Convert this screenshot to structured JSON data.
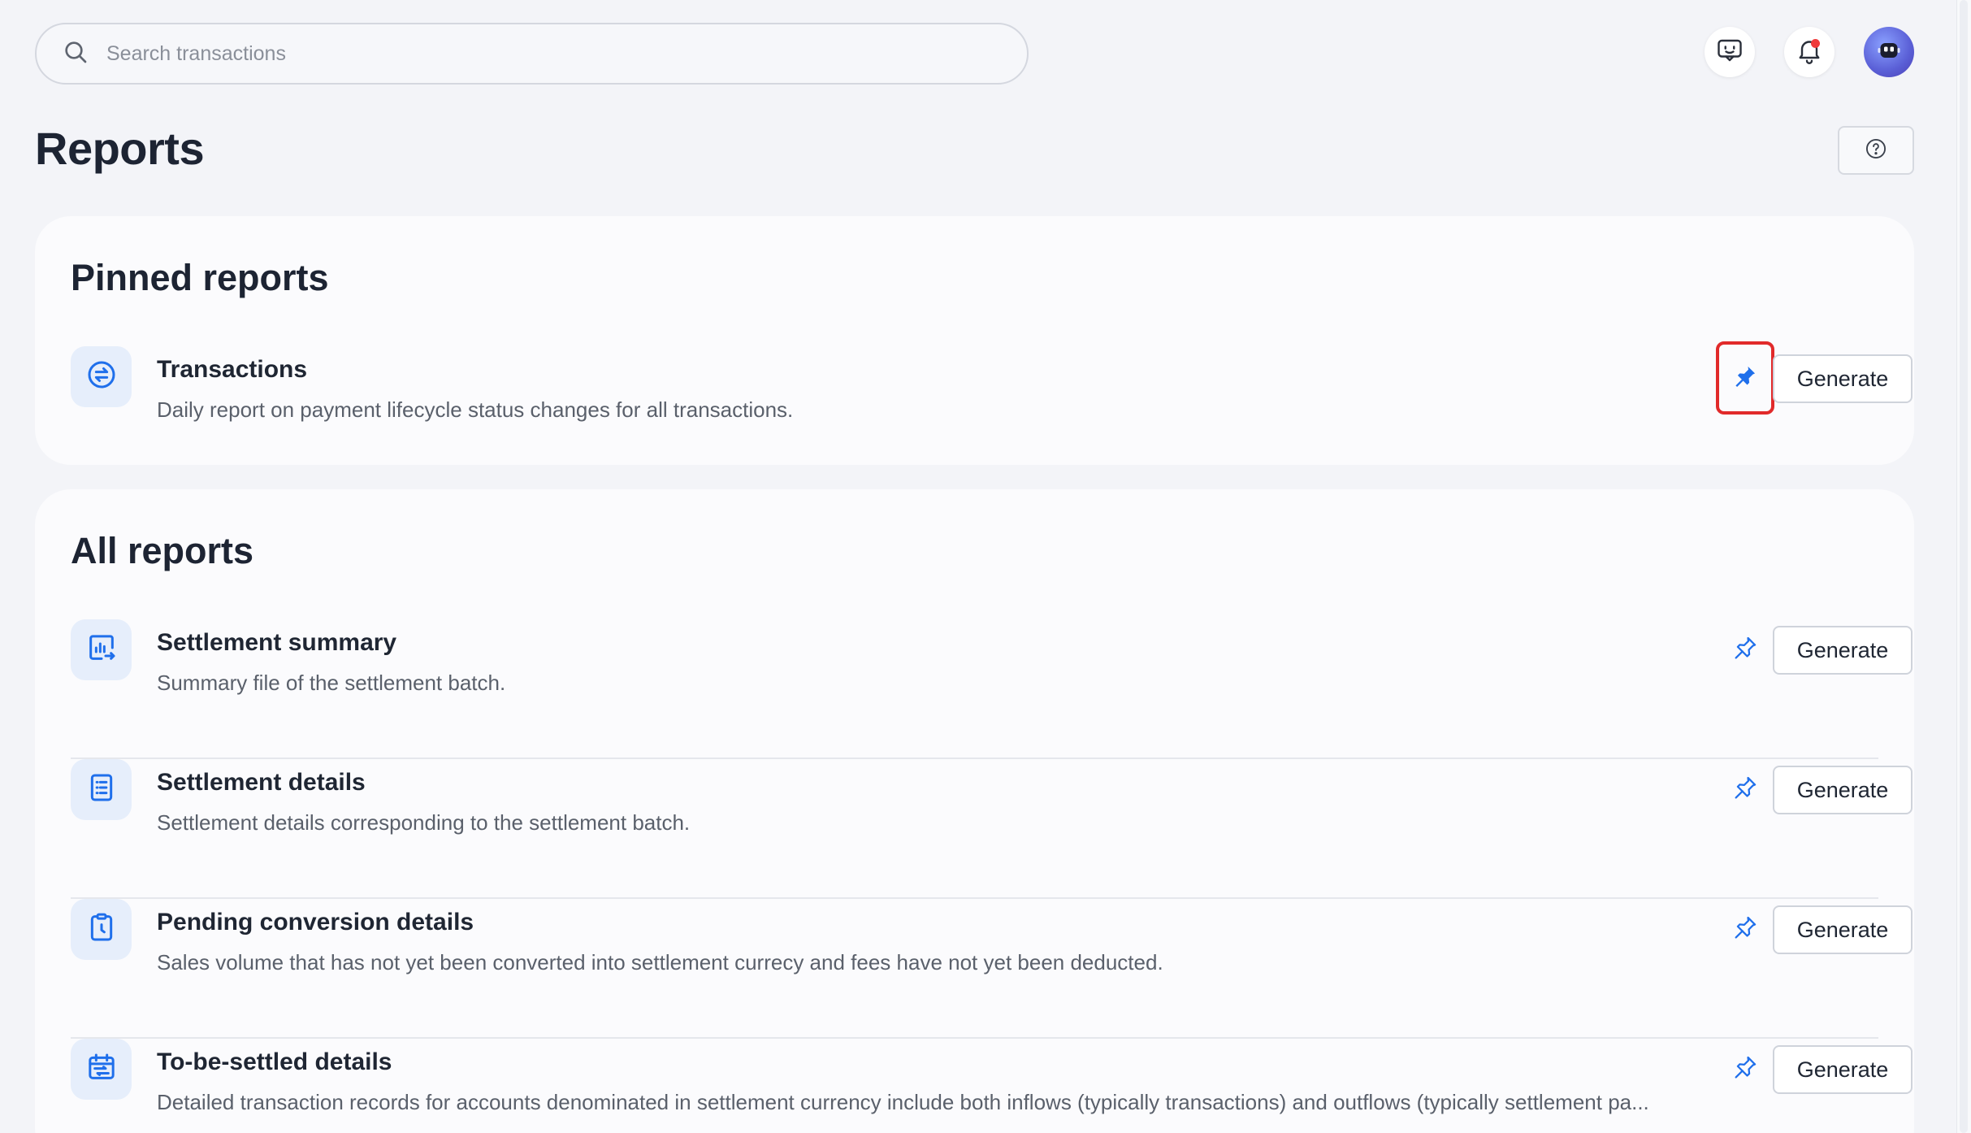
{
  "search": {
    "placeholder": "Search transactions"
  },
  "header": {
    "feedback_icon": "feedback-face-icon",
    "notifications_icon": "bell-icon",
    "avatar_icon": "robot-avatar-icon"
  },
  "page": {
    "title": "Reports",
    "help_icon": "question-circle-icon"
  },
  "pinned": {
    "title": "Pinned reports",
    "items": [
      {
        "title": "Transactions",
        "description": "Daily report on payment lifecycle status changes for all transactions.",
        "icon": "exchange-arrows-icon",
        "pinned": true,
        "button": "Generate"
      }
    ]
  },
  "all": {
    "title": "All reports",
    "items": [
      {
        "title": "Settlement summary",
        "description": "Summary file of the settlement batch.",
        "icon": "chart-export-icon",
        "pinned": false,
        "button": "Generate"
      },
      {
        "title": "Settlement details",
        "description": "Settlement details corresponding to the settlement batch.",
        "icon": "document-list-icon",
        "pinned": false,
        "button": "Generate"
      },
      {
        "title": "Pending conversion details",
        "description": "Sales volume that has not yet been converted into settlement currecy and fees have not yet been deducted.",
        "icon": "clipboard-clock-icon",
        "pinned": false,
        "button": "Generate"
      },
      {
        "title": "To-be-settled details",
        "description": "Detailed transaction records for accounts denominated in settlement currency include both inflows (typically transactions) and outflows (typically settlement pa...",
        "icon": "calendar-transfer-icon",
        "pinned": false,
        "button": "Generate"
      }
    ]
  },
  "colors": {
    "accent": "#1f6feb",
    "highlight": "#e12a2a",
    "icon_bg": "#e6eefb"
  }
}
